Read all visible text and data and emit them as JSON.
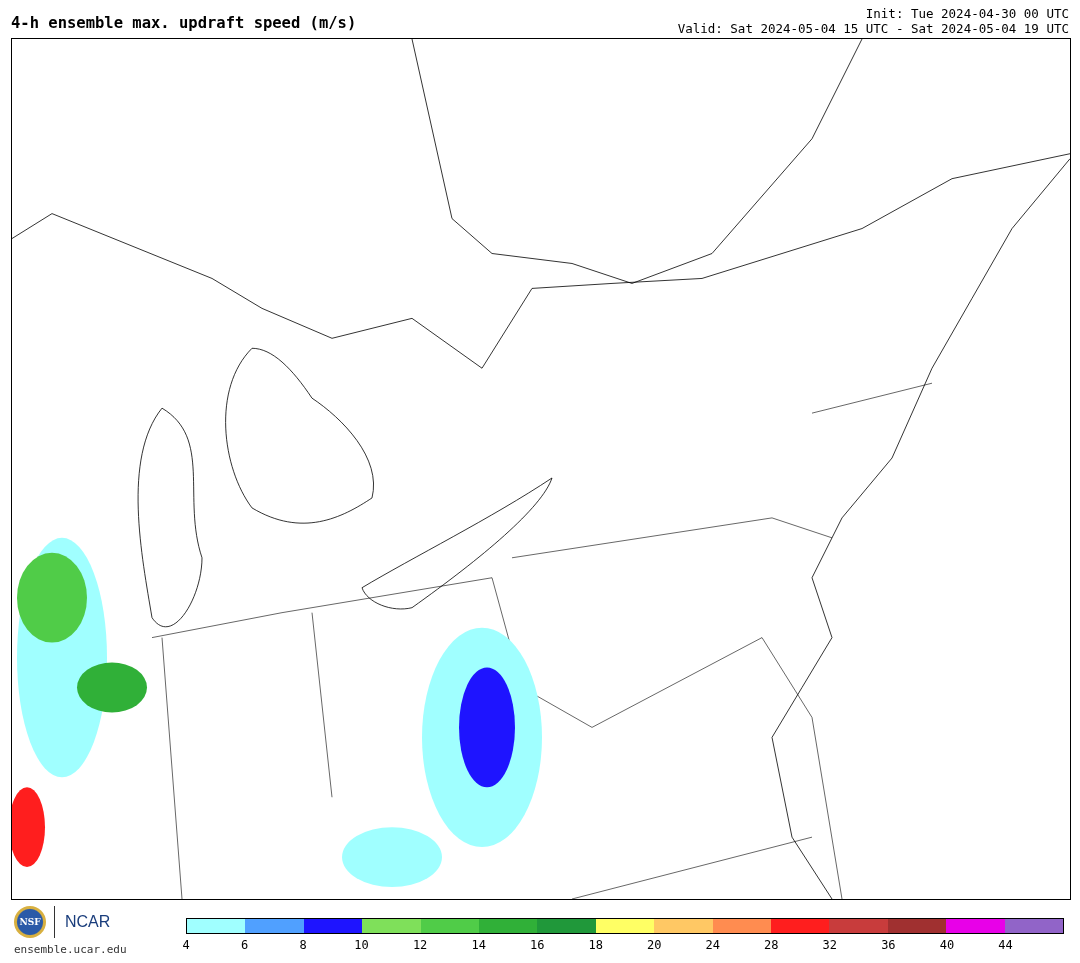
{
  "header": {
    "title": "4-h ensemble max. updraft speed (m/s)",
    "init": "Init: Tue 2024-04-30 00 UTC",
    "valid": "Valid: Sat 2024-05-04 15 UTC - Sat 2024-05-04 19 UTC"
  },
  "footer": {
    "logos": [
      {
        "kind": "nsf",
        "text": "NSF"
      },
      {
        "kind": "ncar",
        "text": "NCAR"
      }
    ],
    "url": "ensemble.ucar.edu"
  },
  "colorbar": {
    "bins": [
      {
        "color": "#a0ffff",
        "label": "4"
      },
      {
        "color": "#50a0ff",
        "label": "6"
      },
      {
        "color": "#1e14ff",
        "label": "8"
      },
      {
        "color": "#7fe05a",
        "label": "10"
      },
      {
        "color": "#50cc48",
        "label": "12"
      },
      {
        "color": "#30b038",
        "label": "14"
      },
      {
        "color": "#20983a",
        "label": "16"
      },
      {
        "color": "#ffff64",
        "label": "18"
      },
      {
        "color": "#ffc864",
        "label": "20"
      },
      {
        "color": "#ff8c50",
        "label": "24"
      },
      {
        "color": "#ff1e1e",
        "label": "28"
      },
      {
        "color": "#c83c3c",
        "label": "32"
      },
      {
        "color": "#a03030",
        "label": "36"
      },
      {
        "color": "#e800e8",
        "label": "40"
      },
      {
        "color": "#9164c8",
        "label": "44"
      }
    ]
  }
}
